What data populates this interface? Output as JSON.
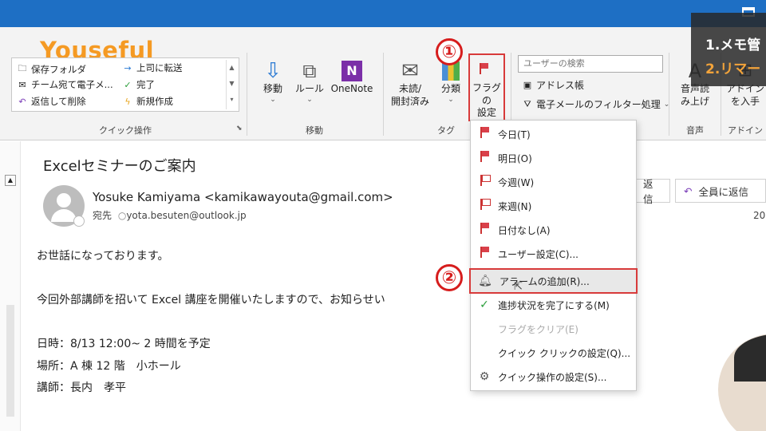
{
  "brand": "Youseful",
  "overlay": {
    "line1": "1.メモ管",
    "line2": "2.リマー"
  },
  "ribbon": {
    "quick_steps": {
      "items": [
        {
          "label": "保存フォルダ",
          "icon": "folder-save-icon"
        },
        {
          "label": "上司に転送",
          "icon": "forward-arrow-icon"
        },
        {
          "label": "チーム宛て電子メ...",
          "icon": "mail-icon"
        },
        {
          "label": "完了",
          "icon": "check-icon"
        },
        {
          "label": "返信して削除",
          "icon": "reply-icon"
        },
        {
          "label": "新規作成",
          "icon": "lightning-icon"
        }
      ],
      "group_label": "クイック操作"
    },
    "move": {
      "move_label": "移動",
      "rules_label": "ルール",
      "onenote_label": "OneNote",
      "group_label": "移動"
    },
    "tags": {
      "unread_label_1": "未読/",
      "unread_label_2": "開封済み",
      "categorize_label": "分類",
      "flag_label_1": "フラグの",
      "flag_label_2": "設定",
      "group_label": "タグ"
    },
    "find": {
      "search_placeholder": "ユーザーの検索",
      "address_book": "アドレス帳",
      "filter_email": "電子メールのフィルター処理"
    },
    "speech": {
      "label_1": "音声読",
      "label_2": "み上げ",
      "group_label": "音声"
    },
    "addins": {
      "label_1": "アドイン",
      "label_2": "を入手",
      "group_label": "アドイン"
    }
  },
  "email": {
    "subject": "Excelセミナーのご案内",
    "sender": "Yosuke Kamiyama <kamikawayouta@gmail.com>",
    "to_label": "宛先",
    "to_address": "yota.besuten@outlook.jp",
    "reply_label": "返信",
    "reply_all_label": "全員に返信",
    "date_partial": "20",
    "body": [
      "お世話になっております。",
      "今回外部講師を招いて Excel 講座を開催いたしますので、お知らせい",
      "日時：8/13 12:00~ 2 時間を予定",
      "場所：A 棟 12 階　小ホール",
      "講師：長内　孝平"
    ]
  },
  "flag_menu": {
    "items": [
      {
        "label": "今日(T)",
        "icon": "flag-icon"
      },
      {
        "label": "明日(O)",
        "icon": "flag-icon"
      },
      {
        "label": "今週(W)",
        "icon": "flag-icon"
      },
      {
        "label": "来週(N)",
        "icon": "flag-icon"
      },
      {
        "label": "日付なし(A)",
        "icon": "flag-icon"
      },
      {
        "label": "ユーザー設定(C)...",
        "icon": "flag-icon"
      },
      {
        "label": "アラームの追加(R)...",
        "icon": "bell-icon"
      },
      {
        "label": "進捗状況を完了にする(M)",
        "icon": "check-icon"
      },
      {
        "label": "フラグをクリア(E)",
        "icon": "none"
      },
      {
        "label": "クイック クリックの設定(Q)...",
        "icon": "none"
      },
      {
        "label": "クイック操作の設定(S)...",
        "icon": "gear-icon"
      }
    ]
  },
  "markers": {
    "one": "①",
    "two": "②"
  },
  "colors": {
    "title_bar": "#1e6fc4",
    "flag_red": "#d9404a",
    "highlight_box": "#d83a3a",
    "brand_orange": "#f59a23"
  }
}
